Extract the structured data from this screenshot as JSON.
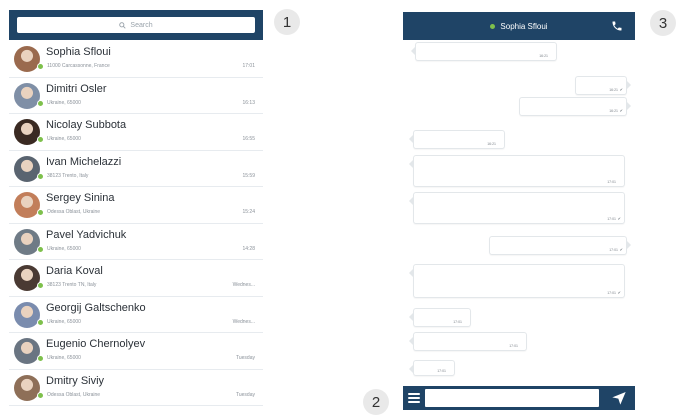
{
  "search": {
    "placeholder": "Search"
  },
  "contacts": [
    {
      "name": "Sophia Sfloui",
      "location": "11000 Carcassonne, France",
      "time": "17:01",
      "avatar_color": "#9a6a4e"
    },
    {
      "name": "Dimitri Osler",
      "location": "Ukraine, 65000",
      "time": "16:13",
      "avatar_color": "#7f8fa6"
    },
    {
      "name": "Nicolay Subbota",
      "location": "Ukraine, 65000",
      "time": "16:55",
      "avatar_color": "#3a2a22"
    },
    {
      "name": "Ivan Michelazzi",
      "location": "38123 Trento, Italy",
      "time": "15:59",
      "avatar_color": "#5a6470"
    },
    {
      "name": "Sergey Sinina",
      "location": "Odessa Oblast, Ukraine",
      "time": "15:24",
      "avatar_color": "#c27e5a"
    },
    {
      "name": "Pavel Yadvichuk",
      "location": "Ukraine, 65000",
      "time": "14:28",
      "avatar_color": "#6f7b86"
    },
    {
      "name": "Daria Koval",
      "location": "38123 Trento TN, Italy",
      "time": "Wednes...",
      "avatar_color": "#4a3a33"
    },
    {
      "name": "Georgij Galtschenko",
      "location": "Ukraine, 65000",
      "time": "Wednes...",
      "avatar_color": "#7a8cae"
    },
    {
      "name": "Eugenio Chernolyev",
      "location": "Ukraine, 65000",
      "time": "Tuesday",
      "avatar_color": "#6a7582"
    },
    {
      "name": "Dmitry Siviy",
      "location": "Odessa Oblast, Ukraine",
      "time": "Tuesday",
      "avatar_color": "#8e6f58"
    }
  ],
  "callouts": [
    "1",
    "2",
    "3"
  ],
  "chat": {
    "contact_name": "Sophia Sfloui",
    "online_color": "#7ec04c",
    "header_color": "#1f4466",
    "messages": [
      {
        "dir": "in",
        "text": "",
        "time": "16:21",
        "check": false
      },
      {
        "dir": "out",
        "text": "",
        "time": "16:21",
        "check": true
      },
      {
        "dir": "out",
        "text": "",
        "time": "16:21",
        "check": true
      },
      {
        "dir": "in",
        "text": "",
        "time": "16:21",
        "check": false
      },
      {
        "dir": "in",
        "text": "",
        "time": "17:01",
        "check": false
      },
      {
        "dir": "in",
        "text": "",
        "time": "17:01",
        "check": true
      },
      {
        "dir": "out",
        "text": "",
        "time": "17:01",
        "check": true
      },
      {
        "dir": "in",
        "text": "",
        "time": "17:01",
        "check": true
      },
      {
        "dir": "in",
        "text": "",
        "time": "17:01",
        "check": false
      },
      {
        "dir": "in",
        "text": "",
        "time": "17:01",
        "check": false
      },
      {
        "dir": "in",
        "text": "",
        "time": "17:01",
        "check": false
      }
    ]
  },
  "composer": {
    "value": ""
  }
}
